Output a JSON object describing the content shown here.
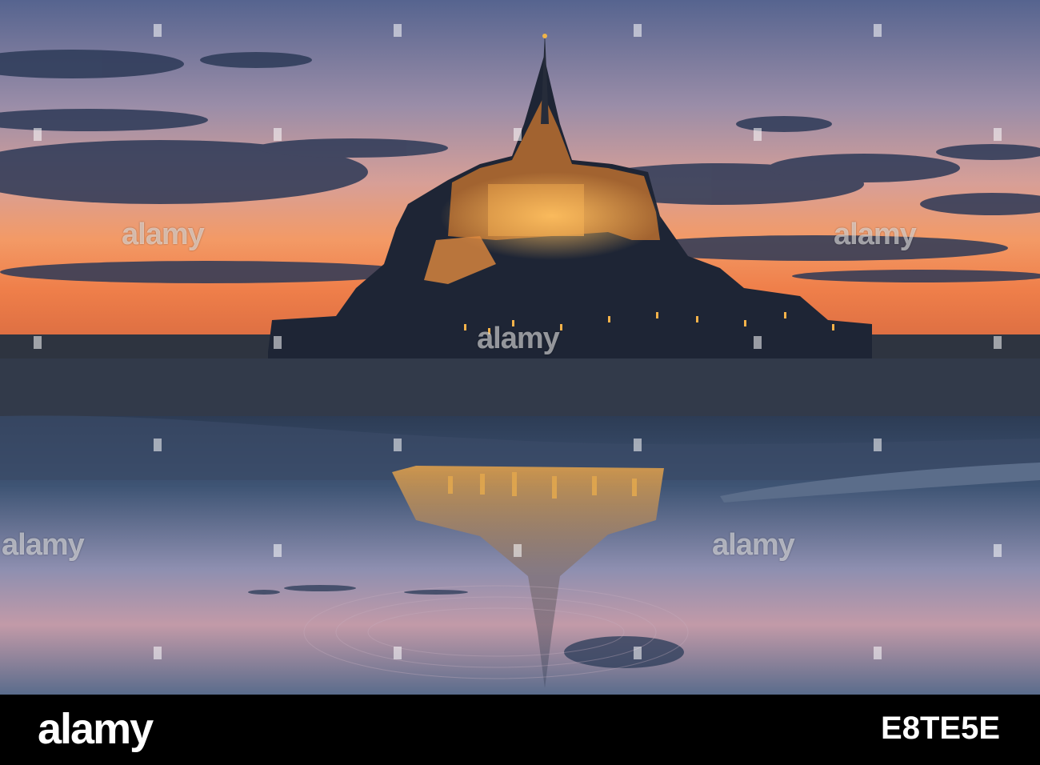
{
  "photo": {
    "subject": "Mont Saint-Michel at dusk with reflection on tidal flats",
    "colors": {
      "sky_top": "#5f6d98",
      "sky_mid": "#c9a2a9",
      "sunset": "#f08a52",
      "water": "#3b4f6e",
      "lights": "#f5b040"
    }
  },
  "watermark": {
    "text": "alamy"
  },
  "footer": {
    "brand": "alamy",
    "image_id": "E8TE5E"
  }
}
